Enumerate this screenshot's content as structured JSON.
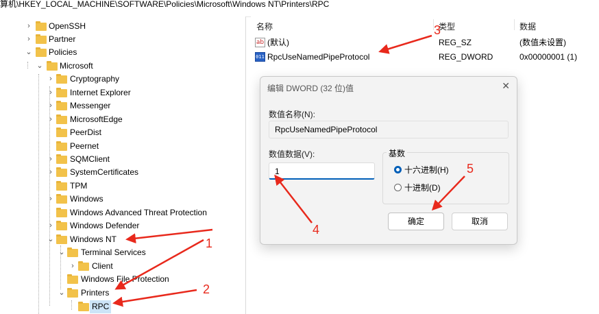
{
  "address_bar": {
    "path": "算机\\HKEY_LOCAL_MACHINE\\SOFTWARE\\Policies\\Microsoft\\Windows NT\\Printers\\RPC"
  },
  "tree": {
    "items": [
      {
        "label": "OpenSSH",
        "chevron": "›"
      },
      {
        "label": "Partner",
        "chevron": "›"
      },
      {
        "label": "Policies",
        "chevron": "⌄"
      },
      {
        "label": "Microsoft",
        "chevron": "⌄"
      },
      {
        "label": "Cryptography",
        "chevron": "›"
      },
      {
        "label": "Internet Explorer",
        "chevron": "›"
      },
      {
        "label": "Messenger",
        "chevron": "›"
      },
      {
        "label": "MicrosoftEdge",
        "chevron": "›"
      },
      {
        "label": "PeerDist",
        "chevron": ""
      },
      {
        "label": "Peernet",
        "chevron": ""
      },
      {
        "label": "SQMClient",
        "chevron": "›"
      },
      {
        "label": "SystemCertificates",
        "chevron": "›"
      },
      {
        "label": "TPM",
        "chevron": ""
      },
      {
        "label": "Windows",
        "chevron": "›"
      },
      {
        "label": "Windows Advanced Threat Protection",
        "chevron": ""
      },
      {
        "label": "Windows Defender",
        "chevron": "›"
      },
      {
        "label": "Windows NT",
        "chevron": "⌄"
      },
      {
        "label": "Terminal Services",
        "chevron": "⌄"
      },
      {
        "label": "Client",
        "chevron": "›"
      },
      {
        "label": "Windows File Protection",
        "chevron": ""
      },
      {
        "label": "Printers",
        "chevron": "⌄"
      },
      {
        "label": "RPC",
        "chevron": ""
      }
    ]
  },
  "values_pane": {
    "headers": {
      "name": "名称",
      "type": "类型",
      "data": "数据"
    },
    "rows": [
      {
        "icon": "ab",
        "name": "(默认)",
        "type": "REG_SZ",
        "data": "(数值未设置)"
      },
      {
        "icon": "011",
        "name": "RpcUseNamedPipeProtocol",
        "type": "REG_DWORD",
        "data": "0x00000001 (1)"
      }
    ]
  },
  "dialog": {
    "title": "编辑 DWORD (32 位)值",
    "close": "✕",
    "value_name_label": "数值名称(N):",
    "value_name": "RpcUseNamedPipeProtocol",
    "value_data_label": "数值数据(V):",
    "value_data": "1",
    "base_label": "基数",
    "radio_hex": "十六进制(H)",
    "radio_dec": "十进制(D)",
    "ok": "确定",
    "cancel": "取消"
  },
  "annotations": {
    "a1": "1",
    "a2": "2",
    "a3": "3",
    "a4": "4",
    "a5": "5"
  },
  "colors": {
    "annotation_red": "#e8291c",
    "accent_blue": "#005fb8",
    "folder_yellow": "#f2c24a"
  }
}
